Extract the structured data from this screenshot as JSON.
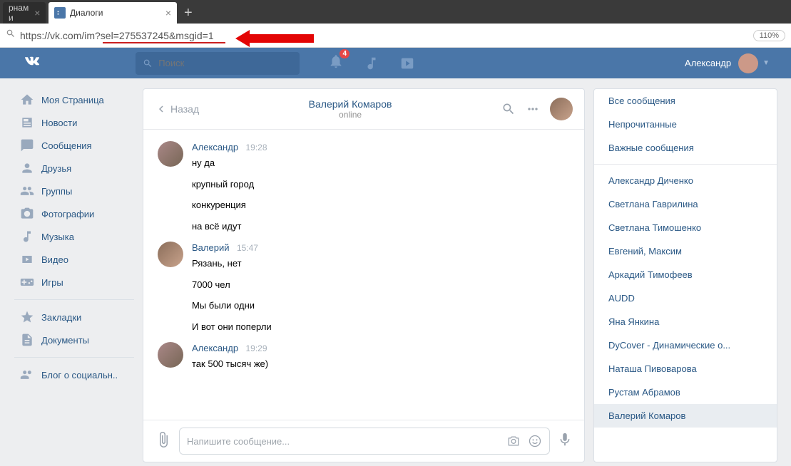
{
  "browser": {
    "tabs": [
      {
        "title": "рнам и",
        "active": false
      },
      {
        "title": "Диалоги",
        "active": true
      }
    ],
    "url": "https://vk.com/im?sel=275537245&msgid=1",
    "zoom": "110%"
  },
  "header": {
    "search_placeholder": "Поиск",
    "notification_count": "4",
    "user_name": "Александр"
  },
  "sidebar": {
    "items": [
      {
        "label": "Моя Страница",
        "icon": "home-icon"
      },
      {
        "label": "Новости",
        "icon": "news-icon"
      },
      {
        "label": "Сообщения",
        "icon": "messages-icon"
      },
      {
        "label": "Друзья",
        "icon": "friends-icon"
      },
      {
        "label": "Группы",
        "icon": "groups-icon"
      },
      {
        "label": "Фотографии",
        "icon": "photos-icon"
      },
      {
        "label": "Музыка",
        "icon": "music-icon"
      },
      {
        "label": "Видео",
        "icon": "video-icon"
      },
      {
        "label": "Игры",
        "icon": "games-icon"
      }
    ],
    "items2": [
      {
        "label": "Закладки",
        "icon": "bookmarks-icon"
      },
      {
        "label": "Документы",
        "icon": "documents-icon"
      }
    ],
    "items3": [
      {
        "label": "Блог о социальн..",
        "icon": "blog-icon"
      }
    ]
  },
  "chat": {
    "back_label": "Назад",
    "contact_name": "Валерий Комаров",
    "contact_status": "online",
    "input_placeholder": "Напишите сообщение...",
    "messages": [
      {
        "author": "Александр",
        "time": "19:28",
        "lines": [
          "ну да",
          "крупный город",
          "конкуренция",
          "на всё идут"
        ]
      },
      {
        "author": "Валерий",
        "time": "15:47",
        "lines": [
          "Рязань, нет",
          "7000 чел",
          "Мы были одни",
          "И вот они поперли"
        ]
      },
      {
        "author": "Александр",
        "time": "19:29",
        "lines": [
          "так 500 тысяч же)"
        ]
      }
    ]
  },
  "right_panel": {
    "filters": [
      "Все сообщения",
      "Непрочитанные",
      "Важные сообщения"
    ],
    "contacts": [
      "Александр Диченко",
      "Светлана Гаврилина",
      "Светлана Тимошенко",
      "Евгений, Максим",
      "Аркадий Тимофеев",
      "AUDD",
      "Яна Янкина",
      "DyCover - Динамические о...",
      "Наташа Пивоварова",
      "Рустам Абрамов",
      "Валерий Комаров"
    ],
    "active_contact": "Валерий Комаров"
  }
}
